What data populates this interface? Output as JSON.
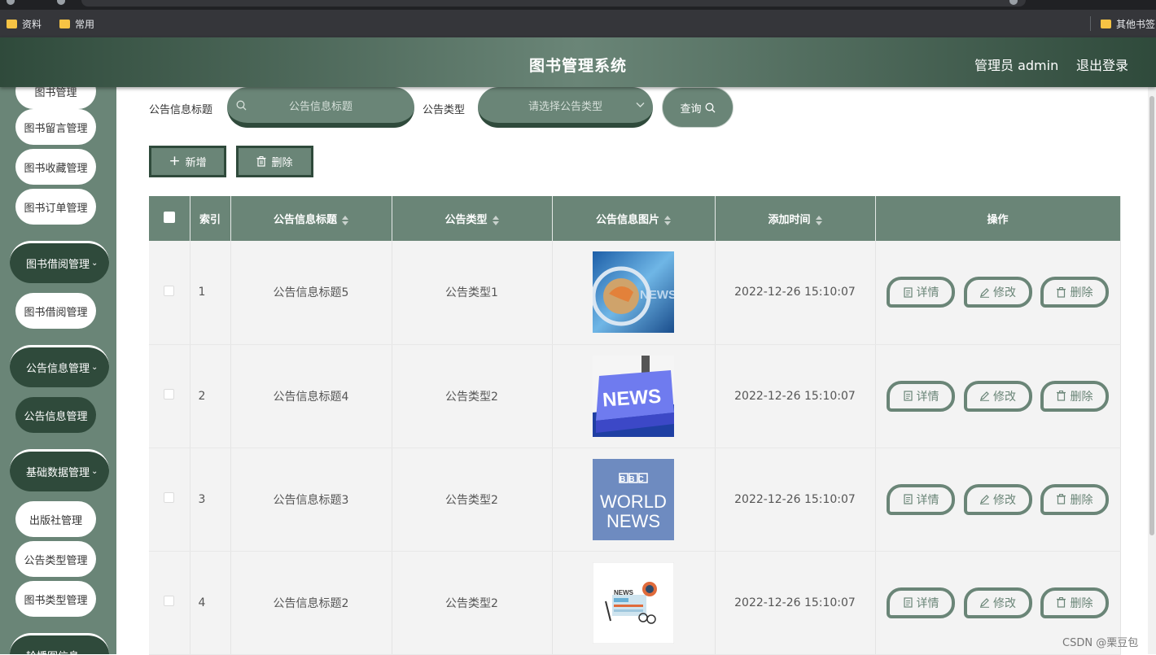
{
  "bookmarks": [
    {
      "label": "资料"
    },
    {
      "label": "常用"
    },
    {
      "label": "其他书签"
    }
  ],
  "header": {
    "title": "图书管理系统",
    "user": "管理员 admin",
    "logout": "退出登录"
  },
  "sidebar": {
    "items": [
      {
        "label": "图书管理"
      },
      {
        "label": "图书留言管理"
      },
      {
        "label": "图书收藏管理"
      },
      {
        "label": "图书订单管理"
      },
      {
        "label": "图书借阅管理"
      },
      {
        "label": "图书借阅管理"
      },
      {
        "label": "公告信息管理"
      },
      {
        "label": "公告信息管理"
      },
      {
        "label": "基础数据管理"
      },
      {
        "label": "出版社管理"
      },
      {
        "label": "公告类型管理"
      },
      {
        "label": "图书类型管理"
      },
      {
        "label": "轮播图信息"
      }
    ]
  },
  "search": {
    "title_label": "公告信息标题",
    "title_placeholder": "公告信息标题",
    "type_label": "公告类型",
    "type_placeholder": "请选择公告类型",
    "query_label": "查询"
  },
  "actions": {
    "add_label": "新增",
    "delete_label": "删除"
  },
  "table": {
    "headers": [
      "索引",
      "公告信息标题",
      "公告类型",
      "公告信息图片",
      "添加时间",
      "操作"
    ],
    "rows": [
      {
        "index": "1",
        "title": "公告信息标题5",
        "type": "公告类型1",
        "image": "news-globe",
        "time": "2022-12-26 15:10:07"
      },
      {
        "index": "2",
        "title": "公告信息标题4",
        "type": "公告类型2",
        "image": "news-key",
        "time": "2022-12-26 15:10:07"
      },
      {
        "index": "3",
        "title": "公告信息标题3",
        "type": "公告类型2",
        "image": "bbc-world-news",
        "time": "2022-12-26 15:10:07"
      },
      {
        "index": "4",
        "title": "公告信息标题2",
        "type": "公告类型2",
        "image": "news-paper",
        "time": "2022-12-26 15:10:07"
      }
    ],
    "row_actions": {
      "detail": "详情",
      "edit": "修改",
      "delete": "删除"
    }
  },
  "bbc_text": {
    "line1": "BBC",
    "line2": "WORLD",
    "line3": "NEWS"
  },
  "news_text": "NEWS",
  "watermark": "CSDN @栗豆包",
  "colors": {
    "primary": "#6a8577",
    "dark": "#2f4a3b",
    "row_bg": "#f3f3f3"
  }
}
